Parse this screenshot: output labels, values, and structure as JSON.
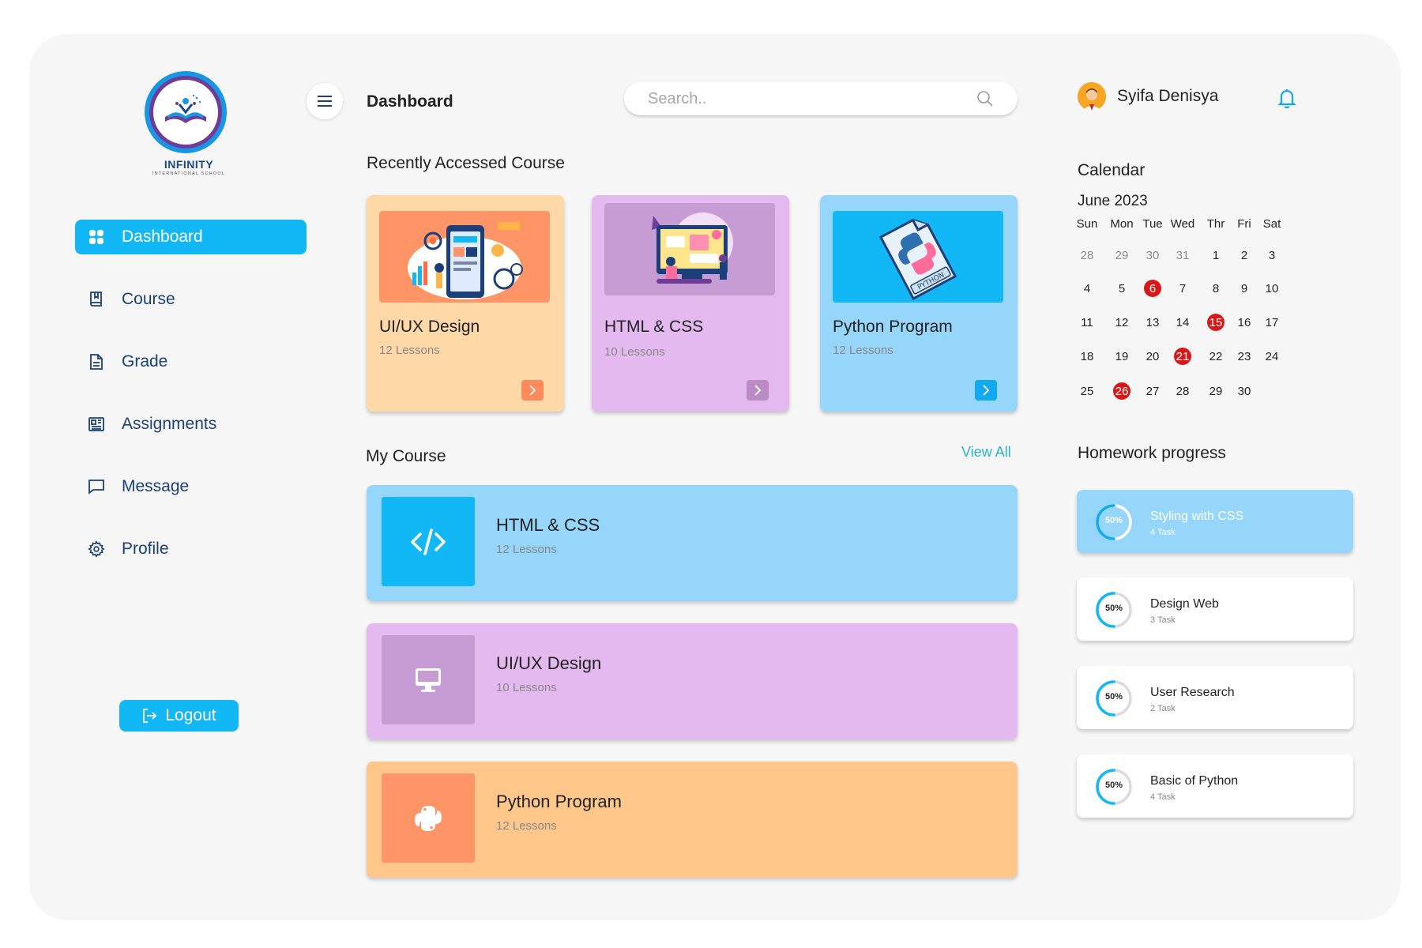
{
  "brand": {
    "name": "INFINITY",
    "subtitle": "INTERNATIONAL SCHOOL"
  },
  "sidebar": {
    "items": [
      {
        "label": "Dashboard",
        "icon": "grid-icon",
        "active": true
      },
      {
        "label": "Course",
        "icon": "book-icon",
        "active": false
      },
      {
        "label": "Grade",
        "icon": "document-icon",
        "active": false
      },
      {
        "label": "Assignments",
        "icon": "newspaper-icon",
        "active": false
      },
      {
        "label": "Message",
        "icon": "chat-icon",
        "active": false
      },
      {
        "label": "Profile",
        "icon": "gear-icon",
        "active": false
      }
    ],
    "logout_label": "Logout"
  },
  "header": {
    "title": "Dashboard",
    "search_placeholder": "Search..",
    "user_name": "Syifa Denisya"
  },
  "recent": {
    "title": "Recently Accessed Course",
    "cards": [
      {
        "name": "UI/UX Design",
        "lessons": "12 Lessons",
        "bg": "#ffd8a8",
        "thumb_bg": "#ff9566",
        "arrow_bg": "#ff8a5b"
      },
      {
        "name": "HTML & CSS",
        "lessons": "10 Lessons",
        "bg": "#e4b9ef",
        "thumb_bg": "#c79bd3",
        "arrow_bg": "#b98cc6"
      },
      {
        "name": "Python Program",
        "lessons": "12 Lessons",
        "bg": "#96d6fb",
        "thumb_bg": "#12b8f5",
        "arrow_bg": "#12a9ee"
      }
    ]
  },
  "my_course": {
    "title": "My Course",
    "view_all": "View All",
    "rows": [
      {
        "name": "HTML & CSS",
        "lessons": "12 Lessons",
        "icon": "code-icon",
        "bg": "#96d6fb",
        "icon_bg": "#12b8f5"
      },
      {
        "name": "UI/UX Design",
        "lessons": "10 Lessons",
        "icon": "monitor-icon",
        "bg": "#e4b9ef",
        "icon_bg": "#c79bd3"
      },
      {
        "name": "Python Program",
        "lessons": "12 Lessons",
        "icon": "python-icon",
        "bg": "#ffc88a",
        "icon_bg": "#ff9566"
      }
    ]
  },
  "calendar": {
    "title": "Calendar",
    "month": "June 2023",
    "weekdays": [
      "Sun",
      "Mon",
      "Tue",
      "Wed",
      "Thr",
      "Fri",
      "Sat"
    ],
    "weeks": [
      [
        "28",
        "29",
        "30",
        "31",
        "1",
        "2",
        "3"
      ],
      [
        "4",
        "5",
        "6",
        "7",
        "8",
        "9",
        "10"
      ],
      [
        "11",
        "12",
        "13",
        "14",
        "15",
        "16",
        "17"
      ],
      [
        "18",
        "19",
        "20",
        "21",
        "22",
        "23",
        "24"
      ],
      [
        "25",
        "26",
        "27",
        "28",
        "29",
        "30",
        ""
      ]
    ],
    "muted_days": [
      "28",
      "29",
      "30",
      "31"
    ],
    "highlighted_days": [
      "6",
      "15",
      "21",
      "26"
    ]
  },
  "homework": {
    "title": "Homework progress",
    "items": [
      {
        "title": "Styling with CSS",
        "tasks": "4 Task",
        "percent": 50,
        "percent_label": "50%",
        "active": true
      },
      {
        "title": "Design Web",
        "tasks": "3 Task",
        "percent": 50,
        "percent_label": "50%",
        "active": false
      },
      {
        "title": "User Research",
        "tasks": "2 Task",
        "percent": 50,
        "percent_label": "50%",
        "active": false
      },
      {
        "title": "Basic of Python",
        "tasks": "4 Task",
        "percent": 50,
        "percent_label": "50%",
        "active": false
      }
    ]
  },
  "colors": {
    "accent": "#12b8f5",
    "nav_text": "#1b3f7a",
    "highlight_day": "#d81818",
    "view_all": "#2ab5c9"
  }
}
